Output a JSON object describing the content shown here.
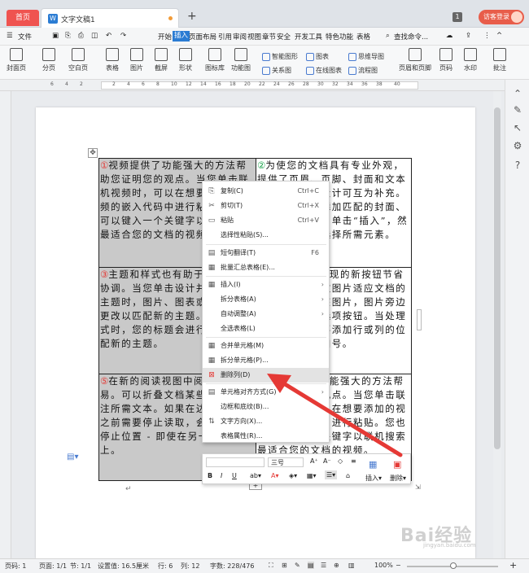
{
  "tabs": {
    "home": "首页",
    "doc_title": "文字文稿1",
    "page_indicator": "1",
    "login": "访客登录"
  },
  "menu": {
    "file": "文件",
    "items": [
      "开始",
      "插入",
      "页面布局",
      "引用",
      "审阅",
      "视图",
      "章节",
      "安全",
      "开发工具",
      "特色功能",
      "表格"
    ],
    "active": "插入",
    "search": "查找命令..."
  },
  "ribbon": {
    "big": [
      "封面页",
      "分页",
      "空白页",
      "表格",
      "图片",
      "截屏",
      "形状",
      "图标库",
      "功能图",
      "智能图形",
      "关系图",
      "图表",
      "在线图表",
      "思维导图",
      "流程图",
      "页眉和页脚",
      "页码",
      "水印",
      "批注"
    ]
  },
  "ruler_numbers": [
    "6",
    "4",
    "2",
    "2",
    "4",
    "6",
    "8",
    "10",
    "12",
    "14",
    "16",
    "18",
    "20",
    "22",
    "24",
    "26",
    "28",
    "30",
    "32",
    "34",
    "36",
    "38",
    "40"
  ],
  "table": {
    "cells": [
      {
        "num": "①",
        "text": "视频提供了功能强大的方法帮助您证明您的观点。当您单击联机视频时，可以在想要添加的视频的嵌入代码中进行粘贴。您也可以键入一个关键字以联机搜索最适合您的文档的视频。"
      },
      {
        "num": "②",
        "text": "为使您的文档具有专业外观，提供了页眉、页脚、封面和文本框设计，这些设计可互为补充。例如，您可以添加匹配的封面、页眉和提要栏。单击“插入”，然后从不同库中选择所需元素。"
      },
      {
        "num": "③",
        "text": "主题和样式也有助于文档保持协调。当您单击设计并选择新的主题时，图片、图表或图形将会更改以匹配新的主题。当应用样式时，您的标题会进行更改以匹配新的主题。"
      },
      {
        "num": "④",
        "text": "在需要位置出现的新按钮节省时间。若要更改图片适应文档的方式，请单击该图片，图片旁边将会显示布局选项按钮。当处理表格时，单击要添加行或列的位置，然后单击加号。"
      },
      {
        "num": "⑤",
        "text": "在新的阅读视图中阅读更加容易。可以折叠文档某些部分并关注所需文本。如果在达到结尾处之前需要停止读取，会记住您的停止位置 - 即使在另一个设备上。"
      },
      {
        "num": "⑥",
        "text": "视频提供了功能强大的方法帮助您证明您的观点。当您单击联机视频时，可以在想要添加的视频的嵌入代码中进行粘贴。您也可以键入一个关键字以联机搜索最适合您的文档的视频。"
      }
    ]
  },
  "context_menu": [
    {
      "icon": "copy-icon",
      "label": "复制(C)",
      "shortcut": "Ctrl+C"
    },
    {
      "icon": "cut-icon",
      "label": "剪切(T)",
      "shortcut": "Ctrl+X"
    },
    {
      "icon": "paste-icon",
      "label": "粘贴",
      "shortcut": "Ctrl+V"
    },
    {
      "icon": "paste-special-icon",
      "label": "选择性粘贴(S)...",
      "shortcut": ""
    },
    {
      "icon": "translate-icon",
      "label": "短句翻译(T)",
      "shortcut": "F6"
    },
    {
      "icon": "batch-table-icon",
      "label": "批量汇总表格(E)...",
      "shortcut": ""
    },
    {
      "icon": "insert-icon",
      "label": "插入(I)",
      "shortcut": ""
    },
    {
      "icon": "",
      "label": "拆分表格(A)",
      "shortcut": ""
    },
    {
      "icon": "",
      "label": "自动调整(A)",
      "shortcut": ""
    },
    {
      "icon": "",
      "label": "全选表格(L)",
      "shortcut": ""
    },
    {
      "icon": "merge-cells-icon",
      "label": "合并单元格(M)",
      "shortcut": ""
    },
    {
      "icon": "split-cells-icon",
      "label": "拆分单元格(P)...",
      "shortcut": ""
    },
    {
      "icon": "delete-column-icon",
      "label": "删除列(D)",
      "shortcut": ""
    },
    {
      "icon": "align-icon",
      "label": "单元格对齐方式(G)",
      "shortcut": ""
    },
    {
      "icon": "",
      "label": "边框和底纹(B)...",
      "shortcut": ""
    },
    {
      "icon": "text-direction-icon",
      "label": "文字方向(X)...",
      "shortcut": ""
    },
    {
      "icon": "",
      "label": "表格属性(R)...",
      "shortcut": ""
    }
  ],
  "mini_toolbar": {
    "font_size": "三号",
    "insert": "插入",
    "delete": "删除"
  },
  "status": {
    "page": "页码: 1",
    "pages": "页面: 1/1",
    "section": "节: 1/1",
    "setting": "设置值: 16.5厘米",
    "row": "行: 6",
    "col": "列: 12",
    "words": "字数: 228/476",
    "zoom": "100%"
  },
  "watermark": {
    "main": "Bai经验",
    "sub": "jingyan.baidu.com"
  },
  "colors": {
    "accent": "#2b7cd3",
    "red_tab": "#ef5350",
    "arrow": "#e53935"
  }
}
